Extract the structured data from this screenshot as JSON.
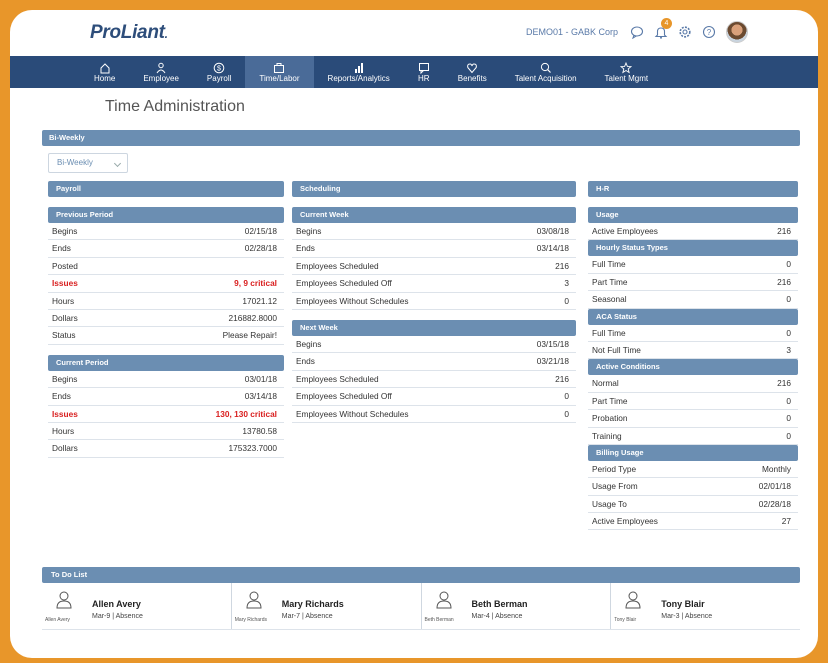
{
  "app": {
    "logo": "ProLiant",
    "company": "DEMO01 - GABK Corp",
    "notification_count": "4"
  },
  "nav": [
    {
      "label": "Home",
      "icon": "home-icon"
    },
    {
      "label": "Employee",
      "icon": "person-icon"
    },
    {
      "label": "Payroll",
      "icon": "dollar-icon"
    },
    {
      "label": "Time/Labor",
      "icon": "briefcase-icon",
      "active": true
    },
    {
      "label": "Reports/Analytics",
      "icon": "bar-chart-icon"
    },
    {
      "label": "HR",
      "icon": "chat-icon"
    },
    {
      "label": "Benefits",
      "icon": "heart-icon"
    },
    {
      "label": "Talent Acquisition",
      "icon": "search-person-icon"
    },
    {
      "label": "Talent Mgmt",
      "icon": "star-icon"
    }
  ],
  "page_title": "Time Administration",
  "biweekly": {
    "header": "Bi-Weekly",
    "dropdown_value": "Bi-Weekly"
  },
  "payroll": {
    "header": "Payroll",
    "previous_period": {
      "header": "Previous Period",
      "rows": [
        {
          "k": "Begins",
          "v": "02/15/18"
        },
        {
          "k": "Ends",
          "v": "02/28/18"
        },
        {
          "k": "Posted",
          "v": ""
        },
        {
          "k": "Issues",
          "v": "9, 9 critical",
          "red": true
        },
        {
          "k": "Hours",
          "v": "17021.12"
        },
        {
          "k": "Dollars",
          "v": "216882.8000"
        },
        {
          "k": "Status",
          "v": "Please Repair!"
        }
      ]
    },
    "current_period": {
      "header": "Current Period",
      "rows": [
        {
          "k": "Begins",
          "v": "03/01/18"
        },
        {
          "k": "Ends",
          "v": "03/14/18"
        },
        {
          "k": "Issues",
          "v": "130, 130 critical",
          "red": true
        },
        {
          "k": "Hours",
          "v": "13780.58"
        },
        {
          "k": "Dollars",
          "v": "175323.7000"
        }
      ]
    }
  },
  "scheduling": {
    "header": "Scheduling",
    "current_week": {
      "header": "Current Week",
      "rows": [
        {
          "k": "Begins",
          "v": "03/08/18"
        },
        {
          "k": "Ends",
          "v": "03/14/18"
        },
        {
          "k": "Employees Scheduled",
          "v": "216"
        },
        {
          "k": "Employees Scheduled Off",
          "v": "3"
        },
        {
          "k": "Employees Without Schedules",
          "v": "0"
        }
      ]
    },
    "next_week": {
      "header": "Next Week",
      "rows": [
        {
          "k": "Begins",
          "v": "03/15/18"
        },
        {
          "k": "Ends",
          "v": "03/21/18"
        },
        {
          "k": "Employees Scheduled",
          "v": "216"
        },
        {
          "k": "Employees Scheduled Off",
          "v": "0"
        },
        {
          "k": "Employees Without Schedules",
          "v": "0"
        }
      ]
    }
  },
  "hr": {
    "header": "H-R",
    "usage": {
      "header": "Usage",
      "rows": [
        {
          "k": "Active Employees",
          "v": "216"
        }
      ]
    },
    "hourly_status": {
      "header": "Hourly Status Types",
      "rows": [
        {
          "k": "Full Time",
          "v": "0"
        },
        {
          "k": "Part Time",
          "v": "216"
        },
        {
          "k": "Seasonal",
          "v": "0"
        }
      ]
    },
    "aca_status": {
      "header": "ACA Status",
      "rows": [
        {
          "k": "Full Time",
          "v": "0"
        },
        {
          "k": "Not Full Time",
          "v": "3"
        }
      ]
    },
    "active_conditions": {
      "header": "Active Conditions",
      "rows": [
        {
          "k": "Normal",
          "v": "216"
        },
        {
          "k": "Part Time",
          "v": "0"
        },
        {
          "k": "Probation",
          "v": "0"
        },
        {
          "k": "Training",
          "v": "0"
        }
      ]
    },
    "billing_usage": {
      "header": "Billing Usage",
      "rows": [
        {
          "k": "Period Type",
          "v": "Monthly"
        },
        {
          "k": "Usage From",
          "v": "02/01/18"
        },
        {
          "k": "Usage To",
          "v": "02/28/18"
        },
        {
          "k": "Active Employees",
          "v": "27"
        }
      ]
    }
  },
  "todo": {
    "header": "To Do List",
    "items": [
      {
        "name": "Allen Avery",
        "short": "Allen Avery",
        "date": "Mar-9",
        "type": "Absence"
      },
      {
        "name": "Mary Richards",
        "short": "Mary Richards",
        "date": "Mar-7",
        "type": "Absence"
      },
      {
        "name": "Beth Berman",
        "short": "Beth Berman",
        "date": "Mar-4",
        "type": "Absence"
      },
      {
        "name": "Tony Blair",
        "short": "Tony Blair",
        "date": "Mar-3",
        "type": "Absence"
      }
    ]
  },
  "colors": {
    "brand_orange": "#e8962a",
    "nav_blue": "#2a4b79",
    "header_blue": "#6b8eb2",
    "critical_red": "#d92020"
  }
}
